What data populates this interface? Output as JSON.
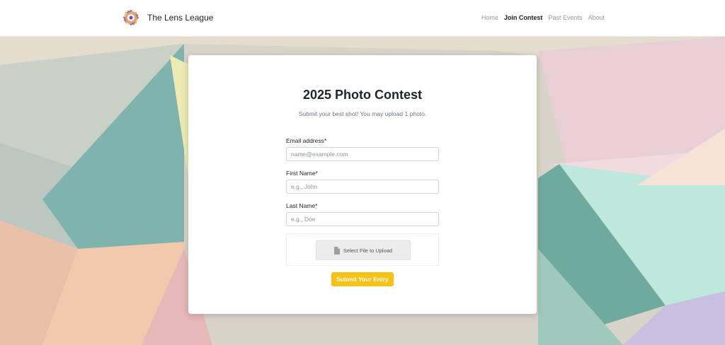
{
  "site": {
    "brand_name": "The Lens League",
    "logo_icon": "starburst-camera-aperture-logo"
  },
  "nav": {
    "items": [
      {
        "label": "Home",
        "active": false
      },
      {
        "label": "Join Contest",
        "active": true
      },
      {
        "label": "Past Events",
        "active": false
      },
      {
        "label": "About",
        "active": false
      }
    ]
  },
  "contest": {
    "title": "2025 Photo Contest",
    "subtitle": "Submit your best shot! You may upload 1 photo."
  },
  "form": {
    "email": {
      "label": "Email address*",
      "placeholder": "name@example.com",
      "value": ""
    },
    "first_name": {
      "label": "First Name*",
      "placeholder": "e.g., John",
      "value": ""
    },
    "last_name": {
      "label": "Last Name*",
      "placeholder": "e.g., Doe",
      "value": ""
    },
    "upload": {
      "label": "Select File to Upload",
      "icon": "file-icon"
    },
    "submit_label": "Submit Your Entry"
  },
  "colors": {
    "accent": "#f7c215",
    "nav_active": "#1c1c1c",
    "nav_inactive": "#9a9a9a"
  }
}
